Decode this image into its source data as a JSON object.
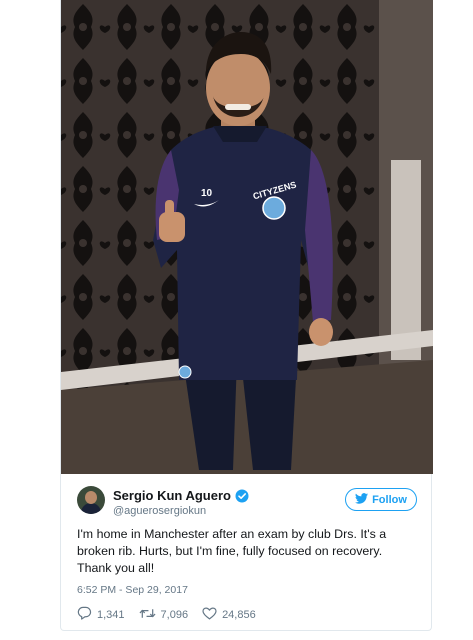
{
  "tweet": {
    "author_name": "Sergio Kun Aguero",
    "handle": "@aguerosergiokun",
    "follow_label": "Follow",
    "text": "I'm home in Manchester after an exam by club Drs. It's a broken rib. Hurts, but I'm fine, fully focused on recovery. Thank you all!",
    "timestamp": "6:52 PM - Sep 29, 2017",
    "replies": "1,341",
    "retweets": "7,096",
    "likes": "24,856"
  },
  "photo": {
    "shirt_number": "10",
    "crest_text": "CITYZENS"
  },
  "colors": {
    "twitter_blue": "#1da1f2",
    "secondary_text": "#657786",
    "primary_text": "#14171a",
    "verified_blue": "#1da1f2"
  },
  "icons": [
    "verified-badge-icon",
    "twitter-bird-icon",
    "reply-icon",
    "retweet-icon",
    "like-icon"
  ]
}
